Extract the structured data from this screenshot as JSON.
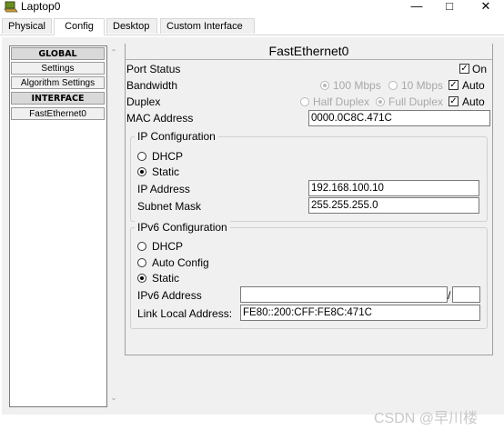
{
  "window": {
    "title": "Laptop0"
  },
  "tabs": [
    "Physical",
    "Config",
    "Desktop",
    "Custom Interface"
  ],
  "active_tab": "Config",
  "sidebar": {
    "items": [
      {
        "label": "GLOBAL",
        "header": true
      },
      {
        "label": "Settings"
      },
      {
        "label": "Algorithm Settings"
      },
      {
        "label": "INTERFACE",
        "header": true
      },
      {
        "label": "FastEthernet0"
      }
    ]
  },
  "panel": {
    "title": "FastEthernet0",
    "port_status": {
      "label": "Port Status",
      "checkbox_label": "On",
      "checked": true
    },
    "bandwidth": {
      "label": "Bandwidth",
      "opt1": "100 Mbps",
      "opt2": "10 Mbps",
      "auto": "Auto",
      "auto_checked": true
    },
    "duplex": {
      "label": "Duplex",
      "opt1": "Half Duplex",
      "opt2": "Full Duplex",
      "auto": "Auto",
      "auto_checked": true
    },
    "mac": {
      "label": "MAC Address",
      "value": "0000.0C8C.471C"
    },
    "ip_config": {
      "title": "IP Configuration",
      "dhcp": "DHCP",
      "static": "Static",
      "selected": "Static",
      "ip_label": "IP Address",
      "ip_value": "192.168.100.10",
      "mask_label": "Subnet Mask",
      "mask_value": "255.255.255.0"
    },
    "ipv6_config": {
      "title": "IPv6 Configuration",
      "dhcp": "DHCP",
      "auto": "Auto Config",
      "static": "Static",
      "selected": "Static",
      "addr_label": "IPv6 Address",
      "addr_value": "",
      "slash": "/",
      "prefix_value": "",
      "link_local_label": "Link Local Address:",
      "link_local_value": "FE80::200:CFF:FE8C:471C"
    }
  },
  "watermark": "CSDN @早川楼"
}
